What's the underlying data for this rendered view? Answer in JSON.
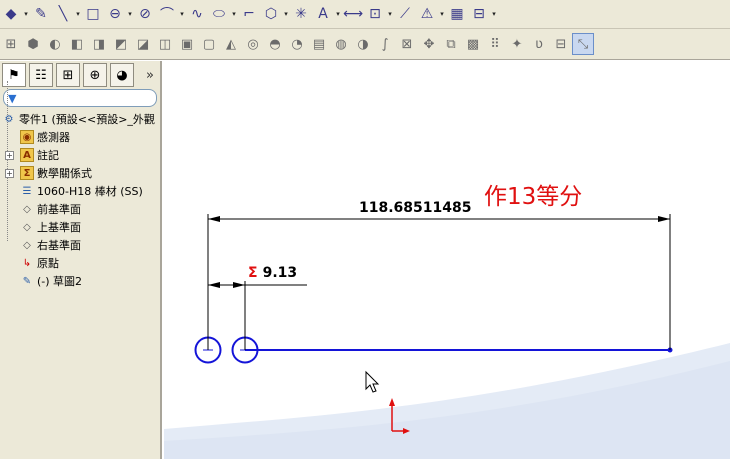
{
  "toolbar_top": {
    "buttons": [
      {
        "name": "smart-dimension-icon",
        "glyph": "◆"
      },
      {
        "name": "sketch-icon",
        "glyph": "✎"
      },
      {
        "name": "line-icon",
        "glyph": "╲"
      },
      {
        "name": "rectangle-icon",
        "glyph": "□"
      },
      {
        "name": "slot-icon",
        "glyph": "⊖"
      },
      {
        "name": "circle-icon",
        "glyph": "⊘"
      },
      {
        "name": "arc-icon",
        "glyph": "⌒"
      },
      {
        "name": "spline-icon",
        "glyph": "∿"
      },
      {
        "name": "ellipse-icon",
        "glyph": "⬭"
      },
      {
        "name": "fillet-icon",
        "glyph": "⌐"
      },
      {
        "name": "polygon-icon",
        "glyph": "⬡"
      },
      {
        "name": "point-icon",
        "glyph": "✳"
      },
      {
        "name": "text-icon",
        "glyph": "A"
      },
      {
        "name": "mirror-icon",
        "glyph": "⟷"
      },
      {
        "name": "offset-icon",
        "glyph": "⊡"
      },
      {
        "name": "trim-icon",
        "glyph": "⟋"
      },
      {
        "name": "warning-icon",
        "glyph": "⚠"
      },
      {
        "name": "pattern-icon",
        "glyph": "▦"
      },
      {
        "name": "relations-icon",
        "glyph": "⊟"
      }
    ]
  },
  "toolbar_bottom": {
    "buttons": [
      {
        "name": "view-icon",
        "glyph": "⊞"
      },
      {
        "name": "extrude-icon",
        "glyph": "⬢"
      },
      {
        "name": "revolve-icon",
        "glyph": "◐"
      },
      {
        "name": "sweep-icon",
        "glyph": "◧"
      },
      {
        "name": "loft-icon",
        "glyph": "◨"
      },
      {
        "name": "cut-icon",
        "glyph": "◩"
      },
      {
        "name": "fillet-feature-icon",
        "glyph": "◪"
      },
      {
        "name": "chamfer-icon",
        "glyph": "◫"
      },
      {
        "name": "rib-icon",
        "glyph": "▣"
      },
      {
        "name": "shell-icon",
        "glyph": "▢"
      },
      {
        "name": "draft-icon",
        "glyph": "◭"
      },
      {
        "name": "hole-icon",
        "glyph": "◎"
      },
      {
        "name": "dome-icon",
        "glyph": "◓"
      },
      {
        "name": "wrap-icon",
        "glyph": "◔"
      },
      {
        "name": "linear-pattern-icon",
        "glyph": "▤"
      },
      {
        "name": "circular-pattern-icon",
        "glyph": "◍"
      },
      {
        "name": "mirror-feature-icon",
        "glyph": "◑"
      },
      {
        "name": "curve-icon",
        "glyph": "∫"
      },
      {
        "name": "reference-icon",
        "glyph": "⊠"
      },
      {
        "name": "move-icon",
        "glyph": "✥"
      },
      {
        "name": "split-icon",
        "glyph": "⧉"
      },
      {
        "name": "combine-icon",
        "glyph": "▩"
      },
      {
        "name": "grid-icon",
        "glyph": "⠿"
      },
      {
        "name": "star-icon",
        "glyph": "✦"
      },
      {
        "name": "helix-icon",
        "glyph": "ʋ"
      },
      {
        "name": "section-icon",
        "glyph": "⊟"
      },
      {
        "name": "instant3d-icon",
        "glyph": "⤡"
      }
    ]
  },
  "panel": {
    "tabs": [
      {
        "name": "feature-manager-tab-icon",
        "glyph": "⚑"
      },
      {
        "name": "property-manager-tab-icon",
        "glyph": "☷"
      },
      {
        "name": "configuration-manager-tab-icon",
        "glyph": "⊞"
      },
      {
        "name": "dimxpert-tab-icon",
        "glyph": "⊕"
      },
      {
        "name": "display-manager-tab-icon",
        "glyph": "◕"
      }
    ],
    "more_glyph": "»",
    "filter_glyph": "▼",
    "tree": [
      {
        "label": "零件1 (預設<<預設>_外觀",
        "icon": "part-icon",
        "glyph": "⚙",
        "level": 0,
        "expander": ""
      },
      {
        "label": "感測器",
        "icon": "sensors-folder-icon",
        "glyph": "◉",
        "level": 1,
        "expander": ""
      },
      {
        "label": "註記",
        "icon": "annotations-folder-icon",
        "glyph": "A",
        "level": 1,
        "expander": "+"
      },
      {
        "label": "數學關係式",
        "icon": "equations-folder-icon",
        "glyph": "Σ",
        "level": 1,
        "expander": "+"
      },
      {
        "label": "1060-H18 棒材 (SS)",
        "icon": "material-icon",
        "glyph": "☰",
        "level": 1,
        "expander": ""
      },
      {
        "label": "前基準面",
        "icon": "front-plane-icon",
        "glyph": "◇",
        "level": 1,
        "expander": ""
      },
      {
        "label": "上基準面",
        "icon": "top-plane-icon",
        "glyph": "◇",
        "level": 1,
        "expander": ""
      },
      {
        "label": "右基準面",
        "icon": "right-plane-icon",
        "glyph": "◇",
        "level": 1,
        "expander": ""
      },
      {
        "label": "原點",
        "icon": "origin-icon",
        "glyph": "↳",
        "level": 1,
        "expander": ""
      },
      {
        "label": "(-) 草圖2",
        "icon": "sketch-feature-icon",
        "glyph": "✎",
        "level": 1,
        "expander": ""
      }
    ]
  },
  "canvas": {
    "dim_total": "118.68511485",
    "dim_small_symbol": "Σ",
    "dim_small": "9.13",
    "annotation": "作13等分"
  },
  "colors": {
    "sketch_blue": "#1414d8",
    "annotation_red": "#e01010",
    "origin_red": "#e01010",
    "toolbar_bg": "#ece9d8",
    "floor_gradient": "#dde6f3"
  }
}
